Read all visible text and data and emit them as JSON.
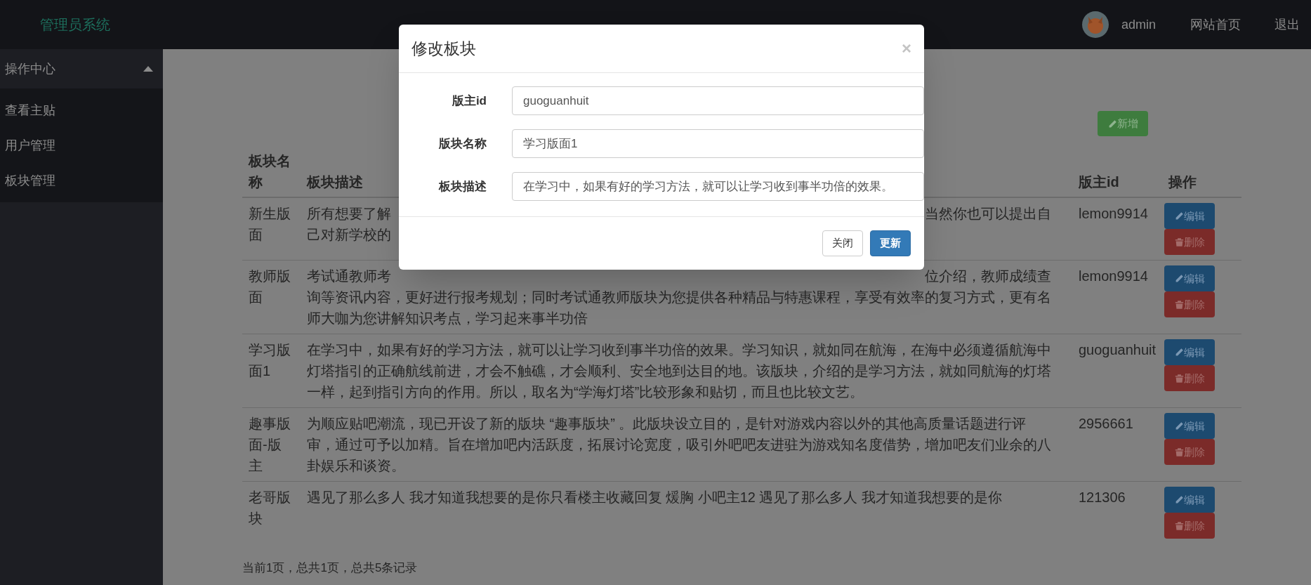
{
  "header": {
    "brand": "管理员系统",
    "user": "admin",
    "links": [
      "网站首页",
      "退出"
    ]
  },
  "sidebar": {
    "group": {
      "label": "操作中心",
      "expanded": true
    },
    "items": [
      "查看主贴",
      "用户管理",
      "板块管理"
    ]
  },
  "toolbar": {
    "add_button": "新增"
  },
  "table": {
    "columns": [
      "板块名称",
      "板块描述",
      "版主id",
      "操作"
    ],
    "rows": [
      {
        "name": "新生版面",
        "description_lines": [
          {
            "left": "所有想要了解",
            "right": "当然你也可以提出自"
          },
          {
            "left": "己对新学校的"
          }
        ],
        "owner": "lemon9914",
        "actions": [
          "编辑",
          "删除"
        ]
      },
      {
        "name": "教师版面",
        "description_lines": [
          {
            "left": "考试通教师考",
            "right": "位介绍，教师成绩查"
          },
          {
            "left": "询等资讯内容，更好进行报考规划；同时考试通教师版块为您提供各种精品与特惠课程，享受有效率的复习方式，更有名"
          },
          {
            "left": "师大咖为您讲解知识考点，学习起来事半功倍"
          }
        ],
        "owner": "lemon9914",
        "actions": [
          "编辑",
          "删除"
        ]
      },
      {
        "name": "学习版面1",
        "description": "在学习中，如果有好的学习方法，就可以让学习收到事半功倍的效果。学习知识，就如同在航海，在海中必须遵循航海中灯塔指引的正确航线前进，才会不触礁，才会顺利、安全地到达目的地。该版块，介绍的是学习方法，就如同航海的灯塔一样，起到指引方向的作用。所以，取名为“学海灯塔”比较形象和贴切，而且也比较文艺。",
        "owner": "guoguanhuit",
        "actions": [
          "编辑",
          "删除"
        ]
      },
      {
        "name": "趣事版面-版主",
        "description": "为顺应贴吧潮流，现已开设了新的版块 “趣事版块” 。此版块设立目的，是针对游戏内容以外的其他高质量话题进行评审，通过可予以加精。旨在增加吧内活跃度，拓展讨论宽度，吸引外吧吧友进驻为游戏知名度借势，增加吧友们业余的八卦娱乐和谈资。",
        "owner": "2956661",
        "actions": [
          "编辑",
          "删除"
        ]
      },
      {
        "name": "老哥版块",
        "description": "遇见了那么多人 我才知道我想要的是你只看楼主收藏回复 煖胸 小吧主12 遇见了那么多人 我才知道我想要的是你",
        "owner": "121306",
        "actions": [
          "编辑",
          "删除"
        ]
      }
    ]
  },
  "footer": "当前1页，总共1页，总共5条记录",
  "modal": {
    "title": "修改板块",
    "close": "×",
    "fields": [
      {
        "label": "版主id",
        "value": "guoguanhuit"
      },
      {
        "label": "版块名称",
        "value": "学习版面1"
      },
      {
        "label": "板块描述",
        "value": "在学习中，如果有好的学习方法，就可以让学习收到事半功倍的效果。"
      }
    ],
    "buttons": [
      {
        "label": "关闭",
        "kind": "default"
      },
      {
        "label": "更新",
        "kind": "primary"
      }
    ]
  }
}
